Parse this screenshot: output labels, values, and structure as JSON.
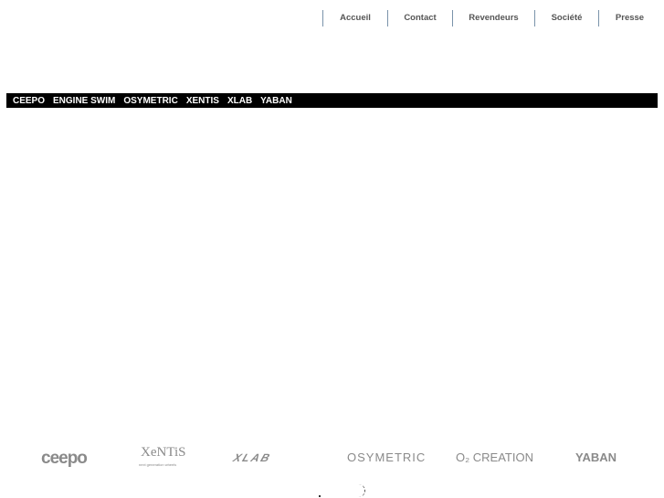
{
  "nav": [
    "Accueil",
    "Contact",
    "Revendeurs",
    "Société",
    "Presse"
  ],
  "brands": [
    "CEEPO",
    "ENGINE SWIM",
    "OSYMETRIC",
    "XENTIS",
    "XLAB",
    "YABAN"
  ],
  "logos": {
    "ceepo": "ceepo",
    "xentis": "XeNTiS",
    "xentis_sub": "next generation wheels",
    "xlab": "XLAB",
    "osymetric": "OSYMETRIC",
    "o2": "O₂ CREATION",
    "yaban": "YABAN"
  }
}
